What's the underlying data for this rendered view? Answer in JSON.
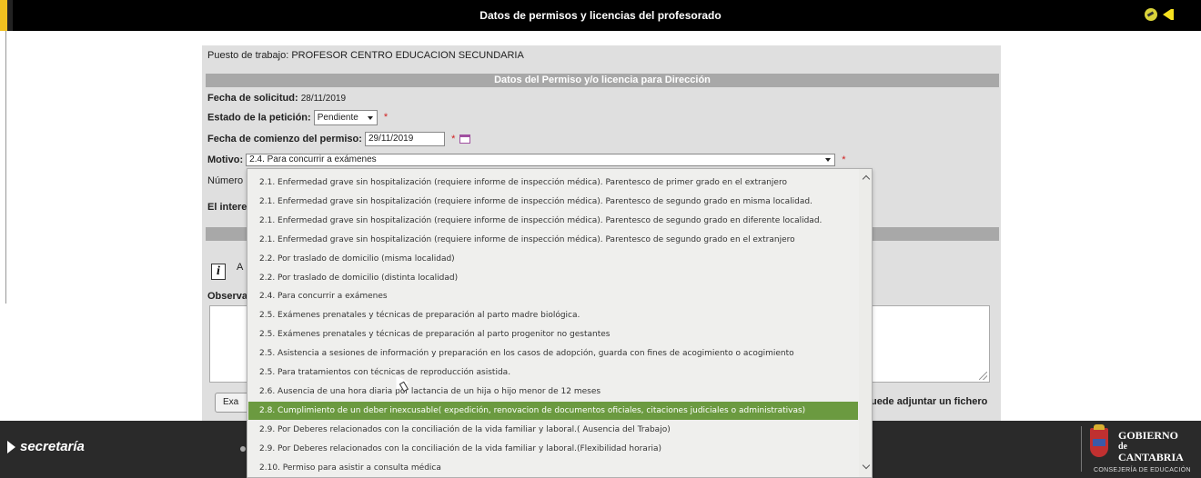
{
  "header": {
    "title": "Datos de permisos y licencias del profesorado",
    "exit_icon": "exit-icon",
    "back_icon": "back-arrow-icon"
  },
  "form": {
    "puesto": "Puesto de trabajo: PROFESOR CENTRO EDUCACION SECUNDARIA",
    "section_title": "Datos del Permiso y/o licencia para Dirección",
    "fecha_solicitud_label": "Fecha de solicitud:",
    "fecha_solicitud_value": "28/11/2019",
    "estado_label": "Estado de la petición:",
    "estado_value": "Pendiente",
    "fecha_comienzo_label": "Fecha de comienzo del permiso:",
    "fecha_comienzo_value": "29/11/2019",
    "motivo_label": "Motivo:",
    "motivo_value": "2.4. Para concurrir a exámenes",
    "required_mark": "*",
    "numero_label": "Número",
    "interesado_label": "El intere",
    "info_partial": "A",
    "observaciones_label": "Observa",
    "exam_button_label": "Exa",
    "attach_text": "uede adjuntar un fichero"
  },
  "dropdown": {
    "items": [
      "2.1. Enfermedad grave sin hospitalización (requiere informe de inspección médica). Parentesco de primer grado en el extranjero",
      "2.1. Enfermedad grave sin hospitalización (requiere informe de inspección médica). Parentesco de segundo grado en misma localidad.",
      "2.1. Enfermedad grave sin hospitalización (requiere informe de inspección médica). Parentesco de segundo grado en diferente localidad.",
      "2.1. Enfermedad grave sin hospitalización (requiere informe de inspección médica). Parentesco de segundo grado en el extranjero",
      "2.2. Por traslado de domicilio (misma localidad)",
      "2.2. Por traslado de domicilio (distinta localidad)",
      "2.4. Para concurrir a exámenes",
      "2.5. Exámenes prenatales y técnicas de preparación al parto madre biológica.",
      "2.5. Exámenes prenatales y técnicas de preparación al parto progenitor no gestantes",
      "2.5. Asistencia a sesiones de información y preparación en los casos de adopción, guarda con fines de acogimiento o acogimiento",
      "2.5. Para tratamientos con técnicas de reproducción asistida.",
      "2.6. Ausencia de una hora diaria por lactancia de un hija o hijo menor de 12 meses",
      "2.8. Cumplimiento de un deber inexcusable( expedición, renovacion de documentos oficiales, citaciones judiciales o administrativas)",
      "2.9. Por Deberes relacionados con la conciliación de la vida familiar y laboral.( Ausencia del Trabajo)",
      "2.9. Por Deberes relacionados con la conciliación de la vida familiar y laboral.(Flexibilidad horaria)",
      "2.10. Permiso para asistir a consulta médica"
    ],
    "highlighted_index": 12,
    "highlight_color": "#6b9a40"
  },
  "footer": {
    "brand": "secretaría",
    "gov_line1": "GOBIERNO",
    "gov_line2": "de",
    "gov_line3": "CANTABRIA",
    "gov_line4": "CONSEJERÍA DE EDUCACIÓN"
  }
}
